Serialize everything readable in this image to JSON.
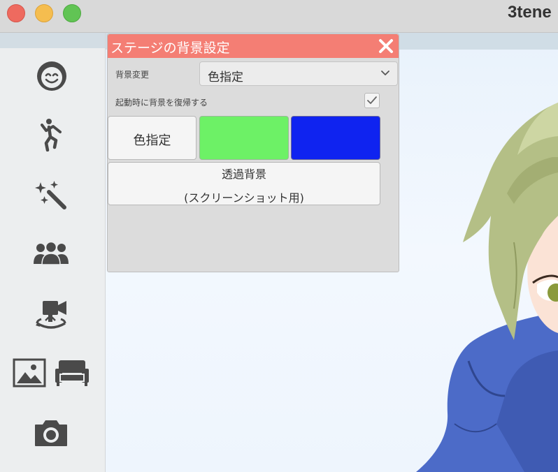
{
  "window": {
    "app_title": "3tene",
    "traffic_lights": [
      "close",
      "minimize",
      "zoom"
    ]
  },
  "sidebar": {
    "items": [
      {
        "name": "face-expression",
        "icon": "smiley-face-icon"
      },
      {
        "name": "motion",
        "icon": "dancing-figure-icon"
      },
      {
        "name": "effects",
        "icon": "magic-wand-icon"
      },
      {
        "name": "characters",
        "icon": "people-group-icon"
      },
      {
        "name": "camera-angle",
        "icon": "video-camera-turntable-icon"
      },
      {
        "name": "background-image",
        "icon": "picture-icon"
      },
      {
        "name": "furniture",
        "icon": "sofa-icon"
      },
      {
        "name": "screenshot",
        "icon": "camera-icon"
      }
    ]
  },
  "dialog": {
    "title": "ステージの背景設定",
    "background_change_label": "背景変更",
    "background_change_value": "色指定",
    "restore_on_startup_label": "起動時に背景を復帰する",
    "restore_on_startup_checked": true,
    "color_select_button": "色指定",
    "swatches": [
      {
        "name": "green",
        "color": "#6df166"
      },
      {
        "name": "blue",
        "color": "#0f23f0"
      }
    ],
    "transparent_button_line1": "透過背景",
    "transparent_button_line2": "(スクリーンショット用)"
  },
  "colors": {
    "dialog_header": "#f47e74",
    "dialog_body": "#dcdcdc",
    "sidebar_icon": "#4a4a4a",
    "hoodie": "#4c6bc8",
    "hair": "#b4bf86"
  }
}
